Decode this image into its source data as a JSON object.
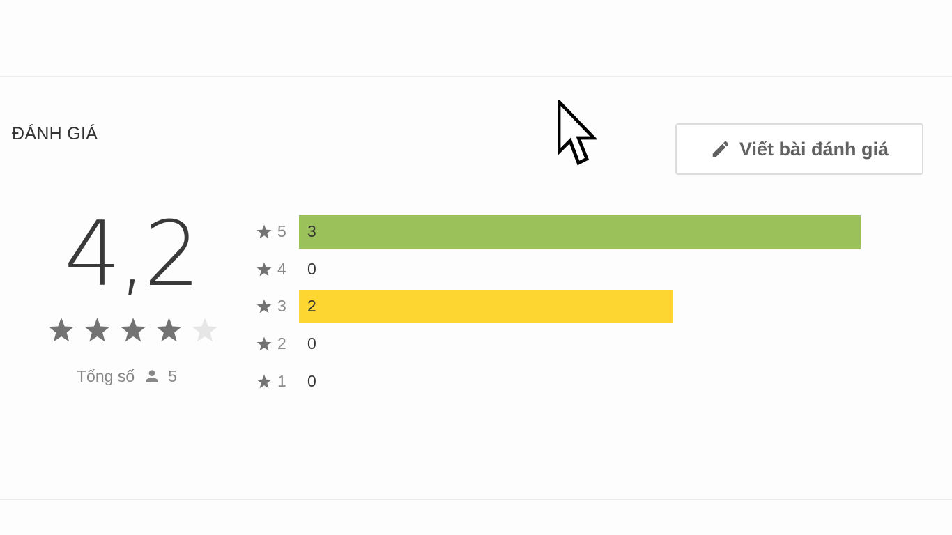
{
  "section_title": "ĐÁNH GIÁ",
  "write_review_button": {
    "label": "Viết bài đánh giá",
    "icon": "pencil-icon"
  },
  "summary": {
    "score": "4,2",
    "stars_filled": 4,
    "stars_total": 5,
    "total_label": "Tổng số",
    "total_icon": "person-icon",
    "total_count": "5"
  },
  "distribution": [
    {
      "level": "5",
      "count": "3",
      "fraction": 1.0,
      "color": "#9bc15a"
    },
    {
      "level": "4",
      "count": "0",
      "fraction": 0,
      "color": "#9bc15a"
    },
    {
      "level": "3",
      "count": "2",
      "fraction": 0.6667,
      "color": "#fdd631"
    },
    {
      "level": "2",
      "count": "0",
      "fraction": 0,
      "color": "#fdd631"
    },
    {
      "level": "1",
      "count": "0",
      "fraction": 0,
      "color": "#f29e3b"
    }
  ],
  "colors": {
    "star_filled": "#737373",
    "star_empty": "#e6e6e6",
    "text_muted": "#888888"
  }
}
